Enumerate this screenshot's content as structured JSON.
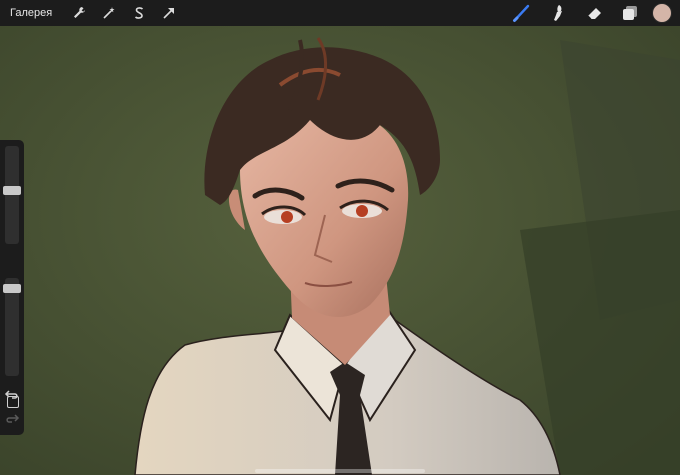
{
  "toolbar": {
    "gallery_label": "Галерея",
    "left_icons": [
      "wrench-icon",
      "magic-wand-icon",
      "selection-s-icon",
      "transform-arrow-icon"
    ],
    "right_icons": [
      "brush-icon",
      "smudge-icon",
      "eraser-icon",
      "layers-icon"
    ],
    "active_tool": "brush",
    "accent_color": "#3a7bf2",
    "current_color": "#d4b5a8"
  },
  "sidebar": {
    "brush_size_level": 0.35,
    "opacity_level": 0.12
  },
  "colors": {
    "background": "#4b5637",
    "toolbar_bg": "#1c1c1c",
    "hair": "#3b2a22",
    "skin": "#d9a48d",
    "shirt": "#d8cfc2",
    "tie": "#2c2522",
    "eyes": "#b63f22"
  }
}
